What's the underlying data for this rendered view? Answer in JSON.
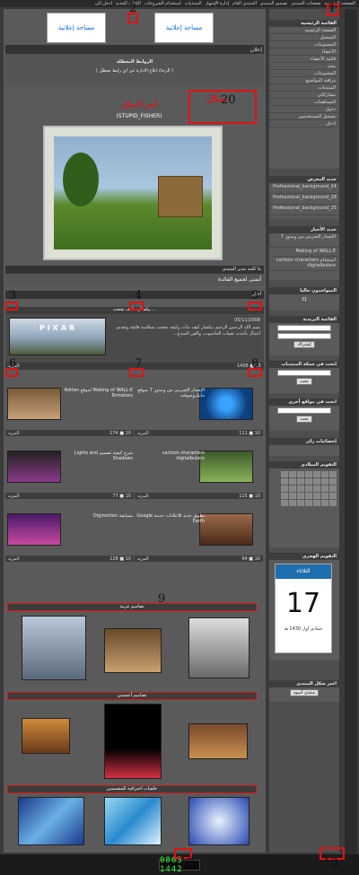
{
  "topnav": [
    "الصفحة الرئيسية",
    "صفحات المنتدى",
    "تصميم المنتدى",
    "المنتدى العام",
    "إدارة الإشهار",
    "المنتديات",
    "استخدام الشروحات",
    "الكتاب الجديد",
    "ادخل الى"
  ],
  "ads": [
    "مساحة إعلانية",
    "مساحة إعلانية"
  ],
  "notice": {
    "title": "إعلان",
    "line1": "الروابط المعطلة",
    "line2": "( الرجاء ابلاغ الادارة عن اي رابط معطل )"
  },
  "markers": [
    "1",
    "2",
    "3",
    "4",
    "5",
    "6",
    "7",
    "8",
    "9",
    "20",
    "12",
    "13"
  ],
  "example_label": "مثال",
  "last_work": {
    "label": "آخر أعمال",
    "author": "(STUPID_FISHER)"
  },
  "manager_word": {
    "title": "ما كلمة مدير المنتدى",
    "value": "أتمنى لجميع الفائدة"
  },
  "news_header": "أخبار",
  "featured": {
    "title": "بيكسار.. كيف تجحت ...",
    "date": "05/11/2008",
    "text": "بسم الله الرحمن الرحيم بيكسار كيف بدأت وكيف نجحت بسلاسة فائقة وتقديم أعمال بأحدث تقنيات الحاسوب، والفن المبدع...",
    "caption": "PIXAR",
    "foot_left": "المزيد",
    "foot_right": "1408 ■ 15"
  },
  "news": [
    {
      "title": "الإصدار التجريبي من ويندوز 7 بموقع مايكروسوفت",
      "foot": "المزيد",
      "meta": "111 ■ 10"
    },
    {
      "title": "Making of WALL-E لموقع Rotten Tomatoes",
      "foot": "المزيد",
      "meta": "174 ■ 10"
    },
    {
      "title": "cartoon characters digitalbuters",
      "foot": "المزيد",
      "meta": "115 ■ 10"
    },
    {
      "title": "شرح كيفية تصميم Lights and Shadows",
      "foot": "المزيد",
      "meta": "77 ■ 10"
    },
    {
      "title": "تطبيق جديد للاعلانات خدمة Google Earth",
      "foot": "المزيد",
      "meta": "94 ■ 10"
    },
    {
      "title": "مسابقة Digimotion",
      "foot": "المزيد",
      "meta": "128 ■ 10"
    }
  ],
  "sections": {
    "s1": "تصاميم غريبة",
    "s2": "تصاميم أعجبتني",
    "s3": "خلفيات احترافية للمصممين"
  },
  "sidebar": {
    "main_list_title": "القائمة الرئيسية",
    "main_items": [
      "الصفحة الرئيسية",
      "التسجيل",
      "المجموعات",
      "الأعضاء",
      "قائمة الأعضاء",
      "بحث",
      "المجموعات",
      "مراقبة المواضيع",
      "المنتديات",
      "مشاركاتي",
      "المساهمات",
      "دخول",
      "تسجيل المستخدمين",
      "ادخل"
    ],
    "new_files_title": "جديد المعرض",
    "new_files": [
      "Professional_background_24",
      "Professional_background_28",
      "Professional_background_25"
    ],
    "news_title": "جديد الأخبار",
    "news_items": [
      "الإصدار التجريبي من ويندوز 7",
      "Making of WALL-E",
      "استخدام cartoon characters digitalbuters"
    ],
    "online_title": "المتواجدون حاليا",
    "online_value": "31",
    "mail_title": "القائمة البريدية",
    "mail_placeholder": "إسمك هنا",
    "mail_button": "إشتراك",
    "search_title": "ابحث في شبكة المنتديات",
    "search_button": "بحث",
    "search2_title": "ابحث في مواقع أخرى",
    "search2_button": "بحث",
    "stats_title": "إحصائيات زائر",
    "calendar_title": "التقويم الميلادي",
    "hijri_title": "التقويم الهجري",
    "hijri_day": "17",
    "hijri_weekday": "الثلاثاء",
    "hijri_month": "جمادى أول 1430 هـ",
    "theme_title": "اختر شكل المنتدى",
    "theme_value": "منتدى أسود"
  },
  "counter": "0863 1442"
}
